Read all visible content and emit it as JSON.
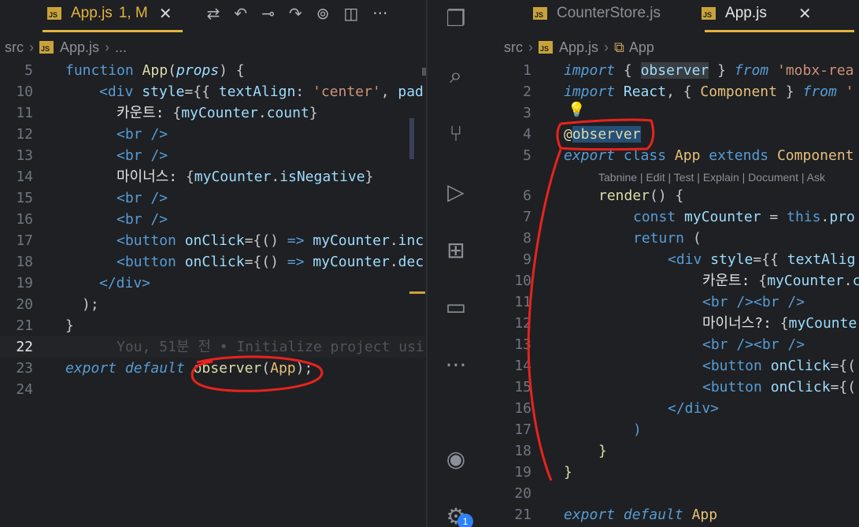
{
  "left": {
    "tab": {
      "label": "App.js",
      "status": "1, M"
    },
    "breadcrumb": [
      "src",
      "App.js",
      "..."
    ],
    "lines": [
      {
        "n": "5",
        "t": "    function App(props) {"
      },
      {
        "n": "10",
        "t": "        <div style={{ textAlign: 'center', pad"
      },
      {
        "n": "11",
        "t": "          카운트: {myCounter.count}"
      },
      {
        "n": "12",
        "t": "          <br />"
      },
      {
        "n": "13",
        "t": "          <br />"
      },
      {
        "n": "14",
        "t": "          마이너스: {myCounter.isNegative}"
      },
      {
        "n": "15",
        "t": "          <br />"
      },
      {
        "n": "16",
        "t": "          <br />"
      },
      {
        "n": "17",
        "t": "          <button onClick={() => myCounter.inc"
      },
      {
        "n": "18",
        "t": "          <button onClick={() => myCounter.dec"
      },
      {
        "n": "19",
        "t": "        </div>"
      },
      {
        "n": "20",
        "t": "      );"
      },
      {
        "n": "21",
        "t": "    }"
      },
      {
        "n": "22",
        "t": "      You, 51분 전 • Initialize project usi"
      },
      {
        "n": "23",
        "t": "    export default observer(App);"
      },
      {
        "n": "24",
        "t": ""
      }
    ]
  },
  "right": {
    "tabs": [
      {
        "label": "CounterStore.js"
      },
      {
        "label": "App.js"
      }
    ],
    "breadcrumb": [
      "src",
      "App.js",
      "App"
    ],
    "codelens": "Tabnine | Edit | Test | Explain | Document | Ask",
    "lines": [
      {
        "n": "1",
        "t": "import { observer } from 'mobx-rea"
      },
      {
        "n": "2",
        "t": "import React, { Component } from '"
      },
      {
        "n": "3",
        "t": ""
      },
      {
        "n": "4",
        "t": "@observer"
      },
      {
        "n": "5",
        "t": "export class App extends Component"
      },
      {
        "n": "6",
        "t": "    render() {"
      },
      {
        "n": "7",
        "t": "        const myCounter = this.prop"
      },
      {
        "n": "8",
        "t": "        return ("
      },
      {
        "n": "9",
        "t": "            <div style={{ textAlig"
      },
      {
        "n": "10",
        "t": "                카운트: {myCounter.c"
      },
      {
        "n": "11",
        "t": "                <br /><br />"
      },
      {
        "n": "12",
        "t": "                마이너스?: {myCounter"
      },
      {
        "n": "13",
        "t": "                <br /><br />"
      },
      {
        "n": "14",
        "t": "                <button onClick={("
      },
      {
        "n": "15",
        "t": "                <button onClick={("
      },
      {
        "n": "16",
        "t": "            </div>"
      },
      {
        "n": "17",
        "t": "        )"
      },
      {
        "n": "18",
        "t": "    }"
      },
      {
        "n": "19",
        "t": "}"
      },
      {
        "n": "20",
        "t": ""
      },
      {
        "n": "21",
        "t": "export default App"
      }
    ]
  },
  "activity": {
    "accounts_badge": "1"
  },
  "colors": {
    "annotation": "#e8231d",
    "accent": "#e3b341"
  }
}
